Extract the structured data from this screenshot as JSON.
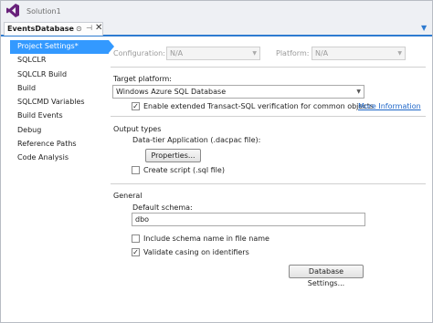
{
  "window": {
    "title": "Solution1"
  },
  "tab": {
    "label": "EventsDatabase",
    "modified_marker": "⊕",
    "pin": "↕"
  },
  "colors": {
    "accent": "#2e7bd0",
    "selection": "#3399ff",
    "logo": "#68217a"
  },
  "sidebar": {
    "items": [
      {
        "label": "Project Settings*",
        "selected": true
      },
      {
        "label": "SQLCLR"
      },
      {
        "label": "SQLCLR Build"
      },
      {
        "label": "Build"
      },
      {
        "label": "SQLCMD Variables"
      },
      {
        "label": "Build Events"
      },
      {
        "label": "Debug"
      },
      {
        "label": "Reference Paths"
      },
      {
        "label": "Code Analysis"
      }
    ]
  },
  "header": {
    "configuration_label": "Configuration:",
    "configuration_value": "N/A",
    "platform_label": "Platform:",
    "platform_value": "N/A"
  },
  "target": {
    "label": "Target platform:",
    "value": "Windows Azure SQL Database",
    "extended_label": "Enable extended Transact-SQL verification for common objects",
    "extended_checked": true,
    "more_info": "More Information"
  },
  "output": {
    "section_label": "Output types",
    "dac_label": "Data-tier Application (.dacpac file):",
    "properties_button": "Properties...",
    "create_script_label": "Create script (.sql file)",
    "create_script_checked": false
  },
  "general": {
    "section_label": "General",
    "default_schema_label": "Default schema:",
    "default_schema_value": "dbo",
    "include_schema_label": "Include schema name in file name",
    "include_schema_checked": false,
    "validate_casing_label": "Validate casing on identifiers",
    "validate_casing_checked": true,
    "database_settings_button": "Database Settings..."
  }
}
